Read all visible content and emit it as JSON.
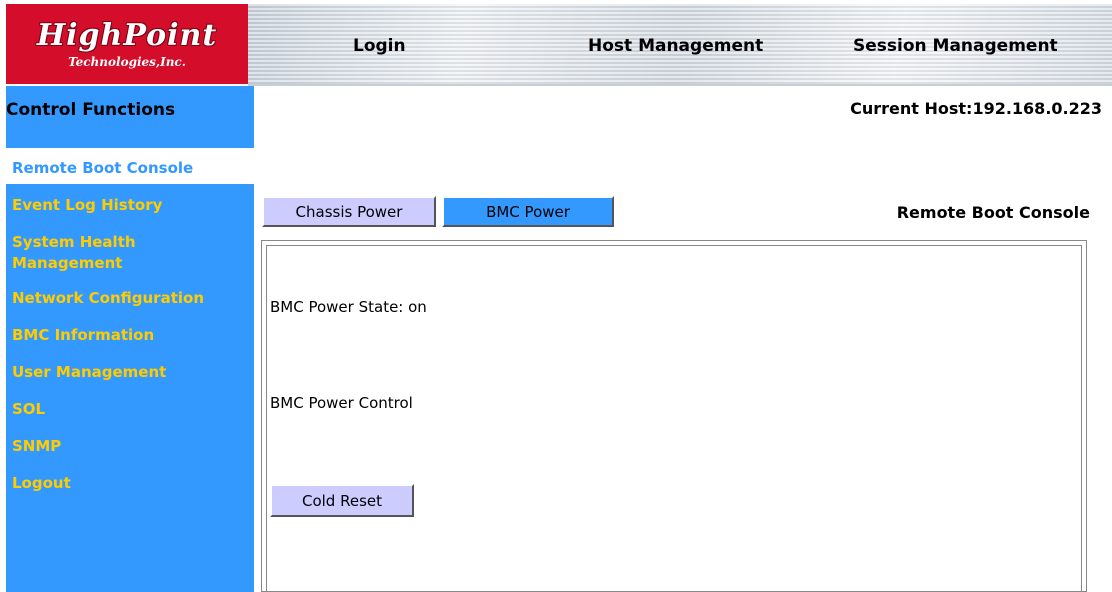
{
  "logo": {
    "name": "HighPoint",
    "tagline": "Technologies,Inc.",
    "color": "#d30d2a"
  },
  "topnav": {
    "login": "Login",
    "host_management": "Host Management",
    "session_management": "Session Management"
  },
  "sidebar": {
    "title": "Control Functions",
    "items": [
      {
        "label": "Remote Boot Console",
        "active": true
      },
      {
        "label": "Event Log History"
      },
      {
        "label": "System Health"
      },
      {
        "label": "Management"
      },
      {
        "label": "Network Configuration"
      },
      {
        "label": "BMC Information"
      },
      {
        "label": "User Management"
      },
      {
        "label": "SOL"
      },
      {
        "label": "SNMP"
      },
      {
        "label": "Logout"
      }
    ],
    "colors": {
      "background": "#3399ff",
      "item": "#ffcc00"
    }
  },
  "header": {
    "current_host": "Current Host:192.168.0.223"
  },
  "tabs": {
    "chassis_power": "Chassis Power",
    "bmc_power": "BMC Power",
    "selected": "BMC Power"
  },
  "section_title": "Remote Boot Console",
  "panel": {
    "power_state": "BMC Power State: on",
    "power_control": "BMC Power Control",
    "cold_reset_button": "Cold Reset"
  }
}
